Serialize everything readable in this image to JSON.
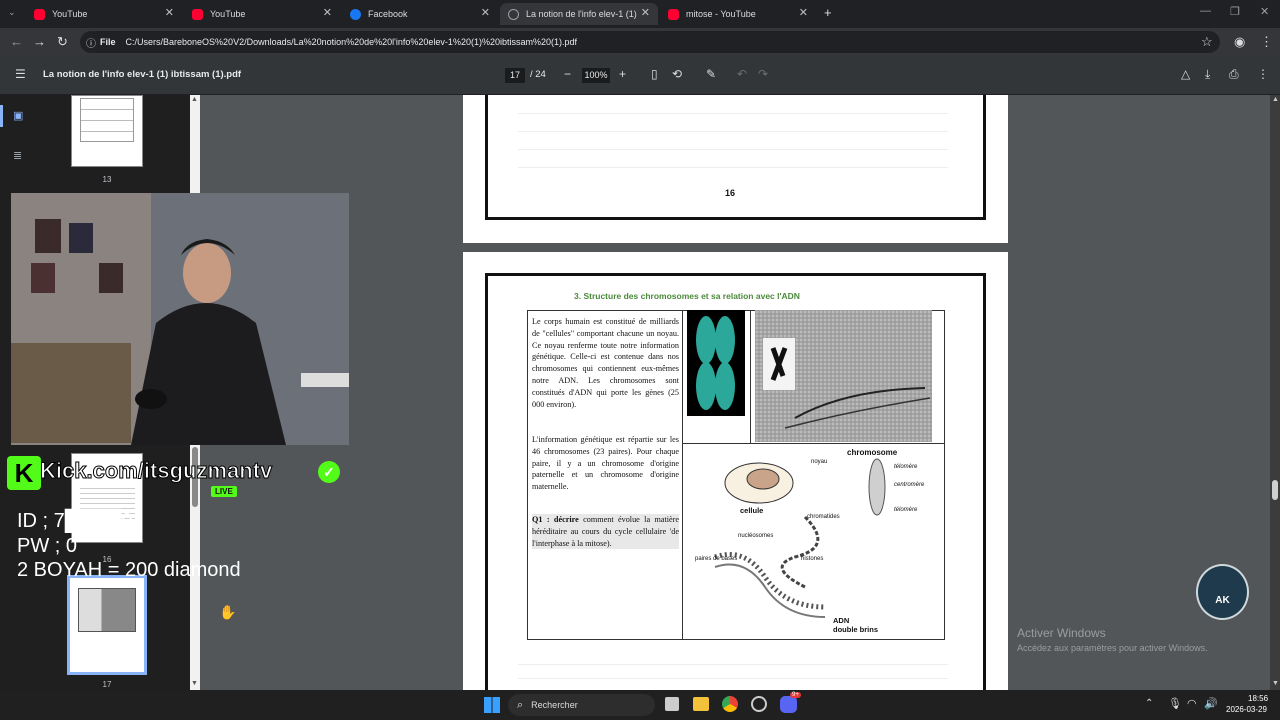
{
  "tabs": [
    {
      "title": "YouTube",
      "color": "#ff0033"
    },
    {
      "title": "YouTube",
      "color": "#ff0033"
    },
    {
      "title": "Facebook",
      "color": "#1877f2"
    },
    {
      "title": "La notion de l'info elev-1 (1) ib",
      "color": "#9aa0a6"
    },
    {
      "title": "mitose - YouTube",
      "color": "#ff0033"
    }
  ],
  "url": {
    "scheme": "File",
    "path": "C:/Users/BareboneOS%20V2/Downloads/La%20notion%20de%20l'info%20elev-1%20(1)%20ibtissam%20(1).pdf"
  },
  "pdf": {
    "filename": "La notion de l'info elev-1 (1) ibtissam (1).pdf",
    "page_current": "17",
    "page_total": "/ 24",
    "zoom": "100%"
  },
  "thumbs": {
    "n13": "13",
    "n16": "16",
    "n17": "17"
  },
  "doc": {
    "prev_page_number": "16",
    "section_title": "3. Structure des chromosomes et sa relation avec l'ADN",
    "paragraph1": "Le corps humain est constitué de milliards de \"cellules\" comportant chacune un noyau. Ce noyau renferme toute notre information génétique. Celle-ci est contenue dans nos chromosomes qui contiennent eux-mêmes notre ADN. Les chromosomes sont constitués d'ADN qui porte les gènes (25 000 environ).",
    "paragraph2": "L'information génétique est répartie sur les 46 chromosomes (23 paires). Pour chaque paire, il y a un chromosome d'origine paternelle et un chromosome d'origine maternelle.",
    "question_label": "Q1 : décrire",
    "question_text": "comment évolue la matière héréditaire au cours du cycle cellulaire 'de l'interphase à la mitose).",
    "diagram": {
      "chromosome": "chromosome",
      "noyau": "noyau",
      "telomere1": "télomère",
      "centromere": "centromère",
      "telomere2": "télomère",
      "cellule": "cellule",
      "chromatides": "chromatides",
      "nucleosomes": "nucléosomes",
      "histones": "histones",
      "paires": "paires de bases",
      "adn": "ADN",
      "double": "double brins"
    }
  },
  "overlay": {
    "kick": "Kick.com/itsguzmantv",
    "live": "LIVE",
    "id_line": "ID ; 7████9",
    "pw_line": "PW ; 0",
    "boyah_line": "2 BOYAH = 200 diamond",
    "ak": "AK"
  },
  "watermark": {
    "title": "Activer Windows",
    "subtitle": "Accédez aux paramètres pour activer Windows."
  },
  "taskbar": {
    "search": "Rechercher",
    "time": "18:56",
    "date": "2026-03-29",
    "notif": "9+"
  }
}
